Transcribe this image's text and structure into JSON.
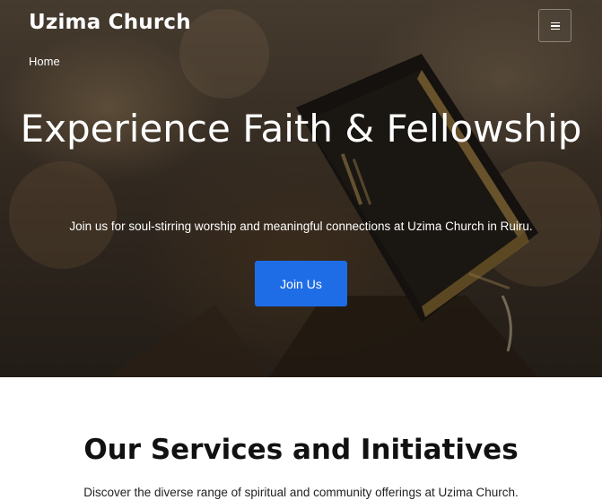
{
  "header": {
    "site_title": "Uzima Church",
    "breadcrumb": "Home",
    "menu_icon": "hamburger-menu-icon"
  },
  "hero": {
    "heading": "Experience Faith & Fellowship",
    "subheading": "Join us for soul-stirring worship and meaningful connections at Uzima Church in Ruiru.",
    "cta_label": "Join Us"
  },
  "services": {
    "heading": "Our Services and Initiatives",
    "subheading": "Discover the diverse range of spiritual and community offerings at Uzima Church."
  },
  "colors": {
    "accent": "#1f6de6",
    "text_light": "#ffffff",
    "text_dark": "#111111"
  }
}
